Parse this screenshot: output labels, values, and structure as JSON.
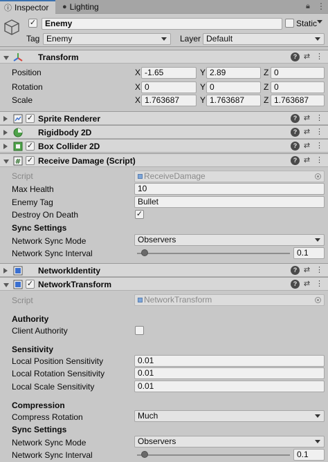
{
  "tabs": {
    "inspector_label": "Inspector",
    "lighting_label": "Lighting"
  },
  "object": {
    "active": true,
    "name": "Enemy",
    "static_label": "Static",
    "static_checked": false,
    "tag_label": "Tag",
    "tag_value": "Enemy",
    "layer_label": "Layer",
    "layer_value": "Default"
  },
  "transform": {
    "title": "Transform",
    "axis_x": "X",
    "axis_y": "Y",
    "axis_z": "Z",
    "position": {
      "label": "Position",
      "x": "-1.65",
      "y": "2.89",
      "z": "0"
    },
    "rotation": {
      "label": "Rotation",
      "x": "0",
      "y": "0",
      "z": "0"
    },
    "scale": {
      "label": "Scale",
      "x": "1.763687",
      "y": "1.763687",
      "z": "1.763687"
    }
  },
  "components": {
    "sprite_renderer": {
      "title": "Sprite Renderer",
      "enabled": true
    },
    "rigidbody": {
      "title": "Rigidbody 2D"
    },
    "box_collider": {
      "title": "Box Collider 2D",
      "enabled": true
    },
    "receive_damage": {
      "title": "Receive Damage (Script)",
      "enabled": true,
      "script_label": "Script",
      "script_value": "ReceiveDamage",
      "max_health_label": "Max Health",
      "max_health_value": "10",
      "enemy_tag_label": "Enemy Tag",
      "enemy_tag_value": "Bullet",
      "destroy_label": "Destroy On Death",
      "destroy_checked": true,
      "sync_settings_label": "Sync Settings",
      "sync_mode_label": "Network Sync Mode",
      "sync_mode_value": "Observers",
      "sync_interval_label": "Network Sync Interval",
      "sync_interval_value": "0.1",
      "sync_interval_fraction": 0.05
    },
    "network_identity": {
      "title": "NetworkIdentity"
    },
    "network_transform": {
      "title": "NetworkTransform",
      "enabled": true,
      "script_label": "Script",
      "script_value": "NetworkTransform",
      "authority_label": "Authority",
      "client_authority_label": "Client Authority",
      "client_authority_checked": false,
      "sensitivity_label": "Sensitivity",
      "local_pos_label": "Local Position Sensitivity",
      "local_pos_value": "0.01",
      "local_rot_label": "Local Rotation Sensitivity",
      "local_rot_value": "0.01",
      "local_scale_label": "Local Scale Sensitivity",
      "local_scale_value": "0.01",
      "compression_label": "Compression",
      "compress_rotation_label": "Compress Rotation",
      "compress_rotation_value": "Much",
      "sync_settings_label": "Sync Settings",
      "sync_mode_label": "Network Sync Mode",
      "sync_mode_value": "Observers",
      "sync_interval_label": "Network Sync Interval",
      "sync_interval_value": "0.1",
      "sync_interval_fraction": 0.05
    }
  },
  "colors": {
    "accent": "#3a72b0",
    "transform_red": "#d8453a",
    "transform_green": "#4fa34a",
    "transform_blue": "#3a6fd0"
  }
}
